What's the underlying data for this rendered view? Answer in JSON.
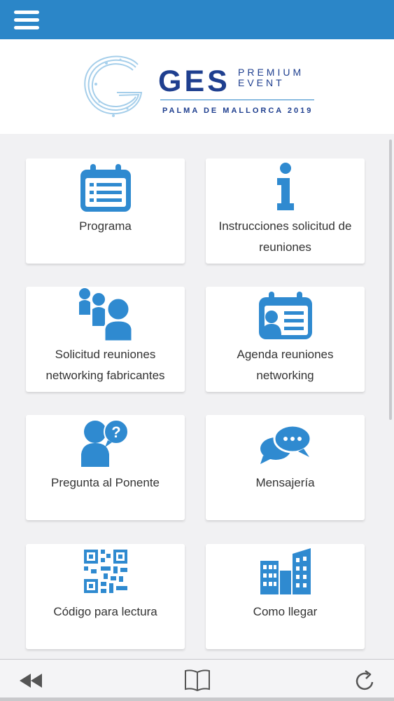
{
  "header": {
    "logo_main": "GES",
    "logo_premium": "PREMIUM",
    "logo_event": "EVENT",
    "logo_location": "PALMA DE MALLORCA 2019"
  },
  "menu_icon": "hamburger-menu-icon",
  "colors": {
    "accent": "#2b86c8",
    "brand_dark": "#1f3f8f",
    "icon_blue": "#2f8ad0"
  },
  "tiles": [
    {
      "icon": "calendar-icon",
      "label": "Programa"
    },
    {
      "icon": "info-icon",
      "label": "Instrucciones solicitud de reuniones"
    },
    {
      "icon": "people-icon",
      "label": "Solicitud reuniones networking fabricantes"
    },
    {
      "icon": "agenda-person-icon",
      "label": "Agenda reuniones networking"
    },
    {
      "icon": "person-question-icon",
      "label": "Pregunta al Ponente"
    },
    {
      "icon": "chat-bubbles-icon",
      "label": "Mensajería"
    },
    {
      "icon": "qr-code-icon",
      "label": "Código para lectura"
    },
    {
      "icon": "buildings-icon",
      "label": "Como llegar"
    }
  ],
  "bottom_bar": {
    "icons": [
      "back-icon",
      "book-icon",
      "refresh-icon"
    ]
  }
}
